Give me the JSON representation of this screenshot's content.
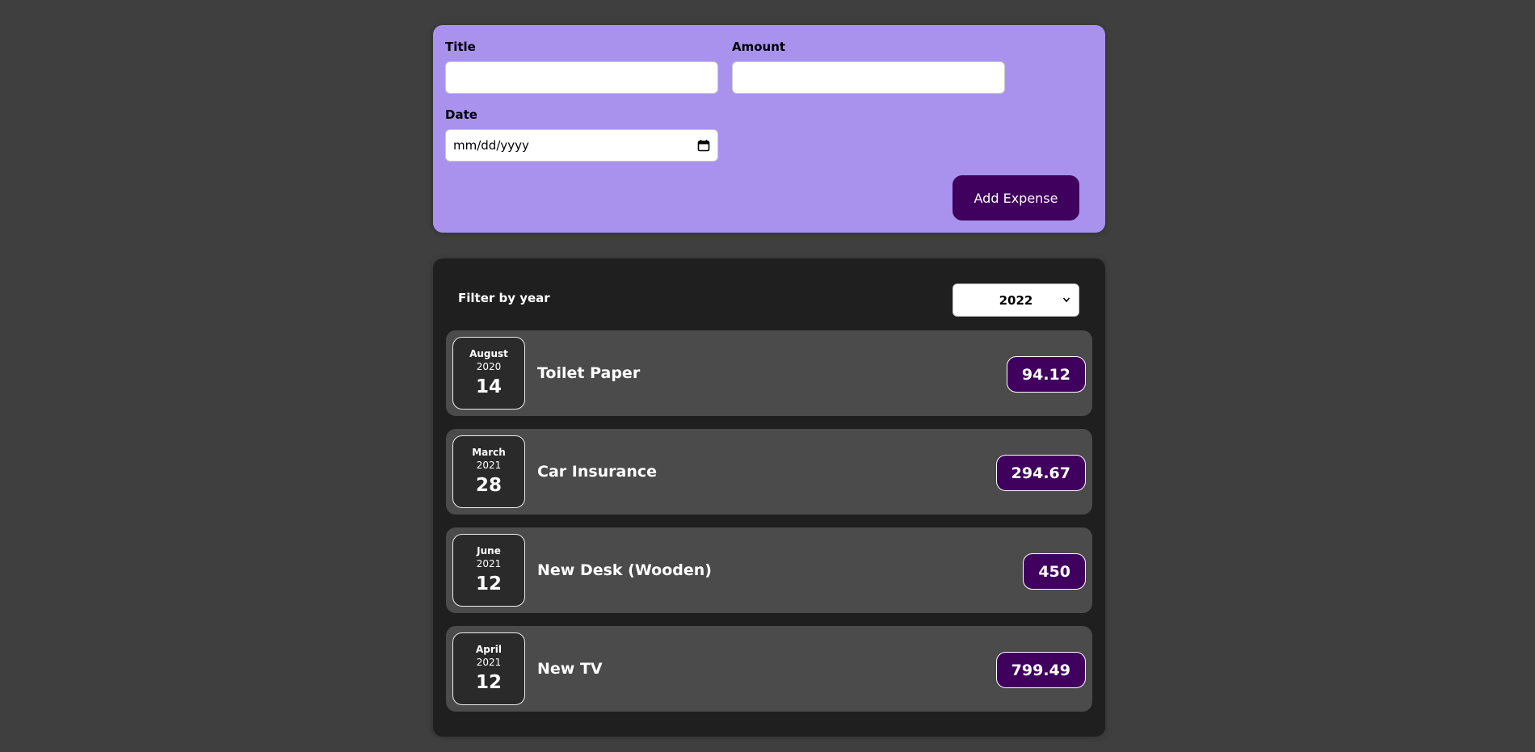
{
  "form": {
    "title_label": "Title",
    "title_value": "",
    "amount_label": "Amount",
    "amount_value": "",
    "date_label": "Date",
    "date_placeholder": "mm/dd/yyyy",
    "submit_label": "Add Expense",
    "icons": {
      "date_picker": "calendar-icon"
    }
  },
  "filter": {
    "label": "Filter by year",
    "selected_year": "2022",
    "icons": {
      "dropdown": "chevron-down-icon"
    }
  },
  "expenses": [
    {
      "month": "August",
      "year": "2020",
      "day": "14",
      "title": "Toilet Paper",
      "amount": "94.12"
    },
    {
      "month": "March",
      "year": "2021",
      "day": "28",
      "title": "Car Insurance",
      "amount": "294.67"
    },
    {
      "month": "June",
      "year": "2021",
      "day": "12",
      "title": "New Desk (Wooden)",
      "amount": "450"
    },
    {
      "month": "April",
      "year": "2021",
      "day": "12",
      "title": "New TV",
      "amount": "799.49"
    }
  ],
  "colors": {
    "background": "#3f3f3f",
    "form_panel": "#a892ee",
    "list_panel": "#1f1f1f",
    "item_background": "#4b4b4b",
    "accent": "#40005d"
  }
}
